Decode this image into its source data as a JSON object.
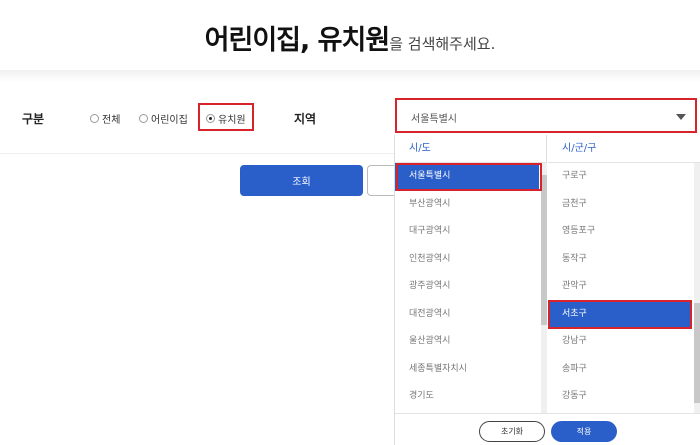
{
  "header": {
    "title_bold": "어린이집, 유치원",
    "title_rest": "을 검색해주세요."
  },
  "filters": {
    "category_label": "구분",
    "options": [
      {
        "label": "전체",
        "selected": false
      },
      {
        "label": "어린이집",
        "selected": false
      },
      {
        "label": "유치원",
        "selected": true
      }
    ],
    "region_label": "지역",
    "region_value": "서울특별시"
  },
  "actions": {
    "search_label": "조회"
  },
  "dropdown": {
    "city_header": "시/도",
    "district_header": "시/군/구",
    "cities": [
      "서울특별시",
      "부산광역시",
      "대구광역시",
      "인천광역시",
      "광주광역시",
      "대전광역시",
      "울산광역시",
      "세종특별자치시",
      "경기도"
    ],
    "selected_city": "서울특별시",
    "districts": [
      "구로구",
      "금천구",
      "영등포구",
      "동작구",
      "관악구",
      "서초구",
      "강남구",
      "송파구",
      "강동구"
    ],
    "selected_district": "서초구",
    "reset_label": "초기화",
    "apply_label": "적용"
  },
  "colors": {
    "accent": "#2a5fc9",
    "highlight": "#d9232a"
  }
}
